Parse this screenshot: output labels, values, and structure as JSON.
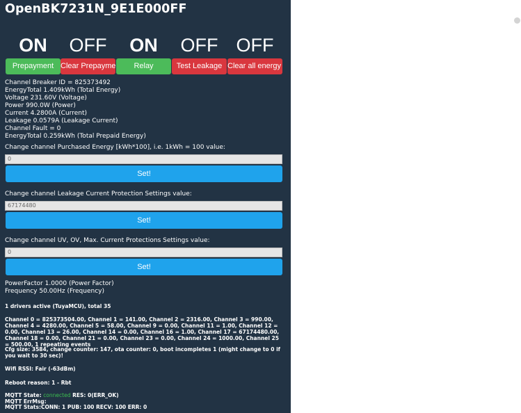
{
  "page": {
    "title": "OpenBK7231N_9E1E000FF"
  },
  "toggles": [
    {
      "state": "ON",
      "label": "Prepayment",
      "color": "#4cbb5a"
    },
    {
      "state": "OFF",
      "label": "Clear Prepayment",
      "color": "#d9373e"
    },
    {
      "state": "ON",
      "label": "Relay",
      "color": "#4cbb5a"
    },
    {
      "state": "OFF",
      "label": "Test Leakage",
      "color": "#d9373e"
    },
    {
      "state": "OFF",
      "label": "Clear all energy counters",
      "color": "#d9373e"
    }
  ],
  "readings": [
    "Channel Breaker ID = 825373492",
    "EnergyTotal 1.409kWh (Total Energy)",
    "Voltage 231.60V (Voltage)",
    "Power 990.0W (Power)",
    "Current 4.2800A (Current)",
    "Leakage 0.0579A (Leakage Current)",
    "Channel Fault = 0",
    "EnergyTotal 0.259kWh (Total Prepaid Energy)"
  ],
  "forms": [
    {
      "label": "Change channel Purchased Energy [kWh*100], i.e. 1kWh = 100 value:",
      "value": "0",
      "button": "Set!"
    },
    {
      "label": "Change channel Leakage Current Protection Settings value:",
      "value": "67174480",
      "button": "Set!"
    },
    {
      "label": "Change channel UV, OV, Max. Current Protections Settings value:",
      "value": "0",
      "button": "Set!"
    }
  ],
  "extra_readings": [
    "PowerFactor 1.0000 (Power Factor)",
    "Frequency 50.00Hz (Frequency)"
  ],
  "info": {
    "drivers": "1 drivers active (TuyaMCU), total 35",
    "channels": "Channel 0 = 825373504.00, Channel 1 = 141.00, Channel 2 = 2316.00, Channel 3 = 990.00, Channel 4 = 4280.00, Channel 5 = 58.00, Channel 9 = 0.00, Channel 11 = 1.00, Channel 12 = 0.00, Channel 13 = 26.00, Channel 14 = 0.00, Channel 16 = 1.00, Channel 17 = 67174480.00, Channel 18 = 0.00, Channel 21 = 0.00, Channel 23 = 0.00, Channel 24 = 1000.00, Channel 25 = 500.00, 1 repeating events",
    "cfg": "Cfg size: 3584, change counter: 147, ota counter: 0, boot incompletes 1 (might change to 0 if you wait to 30 sec)!",
    "wifi": "Wifi RSSI: Fair (-63dBm)",
    "reboot": "Reboot reason: 1 - Rbt",
    "mqtt_state_label": "MQTT State: ",
    "mqtt_state_value": "connected",
    "mqtt_res": " RES: 0(ERR_OK)",
    "mqtt_errmsg": "MQTT ErrMsg:",
    "mqtt_stats": "MQTT Stats:CONN: 1 PUB: 100 RECV: 100 ERR: 0"
  },
  "colors": {
    "panel_bg": "#223344",
    "set_button": "#1fa3ec",
    "connected_text": "#3cbf4f"
  }
}
